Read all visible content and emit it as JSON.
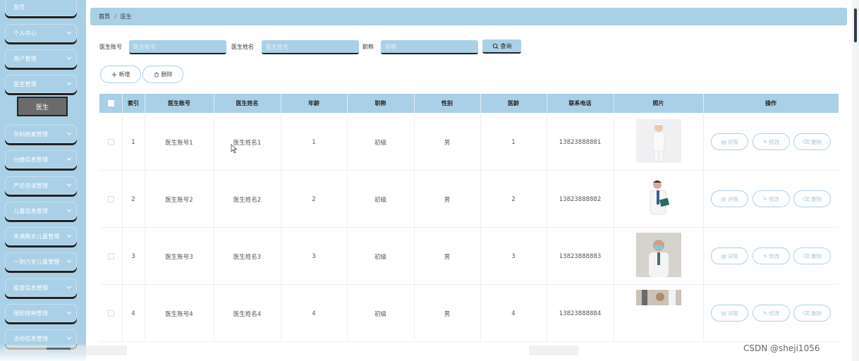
{
  "sidebar": {
    "items": [
      {
        "label": "首页",
        "expandable": false
      },
      {
        "label": "个人中心",
        "expandable": true
      },
      {
        "label": "用户管理",
        "expandable": true
      },
      {
        "label": "医生管理",
        "expandable": true
      },
      {
        "label": "孕妇档案管理",
        "expandable": true
      },
      {
        "label": "分娩信息管理",
        "expandable": true
      },
      {
        "label": "产后访谈管理",
        "expandable": true
      },
      {
        "label": "儿童信息管理",
        "expandable": true
      },
      {
        "label": "未满两岁儿童管理",
        "expandable": true
      },
      {
        "label": "一到六岁儿童管理",
        "expandable": true
      },
      {
        "label": "疫苗信息管理",
        "expandable": true
      },
      {
        "label": "预防接种管理",
        "expandable": true
      },
      {
        "label": "活动信息管理",
        "expandable": true
      }
    ],
    "active_sub": "医生"
  },
  "breadcrumb": {
    "home": "首页",
    "current": "医生"
  },
  "search": {
    "account_label": "医生账号",
    "account_placeholder": "医生账号",
    "name_label": "医生姓名",
    "name_placeholder": "医生姓名",
    "title_label": "职称",
    "title_placeholder": "职称",
    "query_label": "查询"
  },
  "actions": {
    "add_label": "新增",
    "delete_label": "删除"
  },
  "table": {
    "headers": [
      "索引",
      "医生账号",
      "医生姓名",
      "年龄",
      "职称",
      "性别",
      "医龄",
      "联系电话",
      "照片",
      "操作"
    ],
    "rows": [
      {
        "index": "1",
        "account": "医生账号1",
        "name": "医生姓名1",
        "age": "1",
        "title": "初级",
        "gender": "男",
        "years": "1",
        "phone": "13823888881"
      },
      {
        "index": "2",
        "account": "医生账号2",
        "name": "医生姓名2",
        "age": "2",
        "title": "初级",
        "gender": "男",
        "years": "2",
        "phone": "13823888882"
      },
      {
        "index": "3",
        "account": "医生账号3",
        "name": "医生姓名3",
        "age": "3",
        "title": "初级",
        "gender": "男",
        "years": "3",
        "phone": "13823888883"
      },
      {
        "index": "4",
        "account": "医生账号4",
        "name": "医生姓名4",
        "age": "4",
        "title": "初级",
        "gender": "男",
        "years": "4",
        "phone": "13823888884"
      }
    ],
    "row_actions": {
      "detail": "详情",
      "edit": "修改",
      "delete": "删除"
    }
  },
  "watermark": "CSDN @sheji1056",
  "colors": {
    "accent": "#a9d0e6",
    "dark": "#222222"
  }
}
